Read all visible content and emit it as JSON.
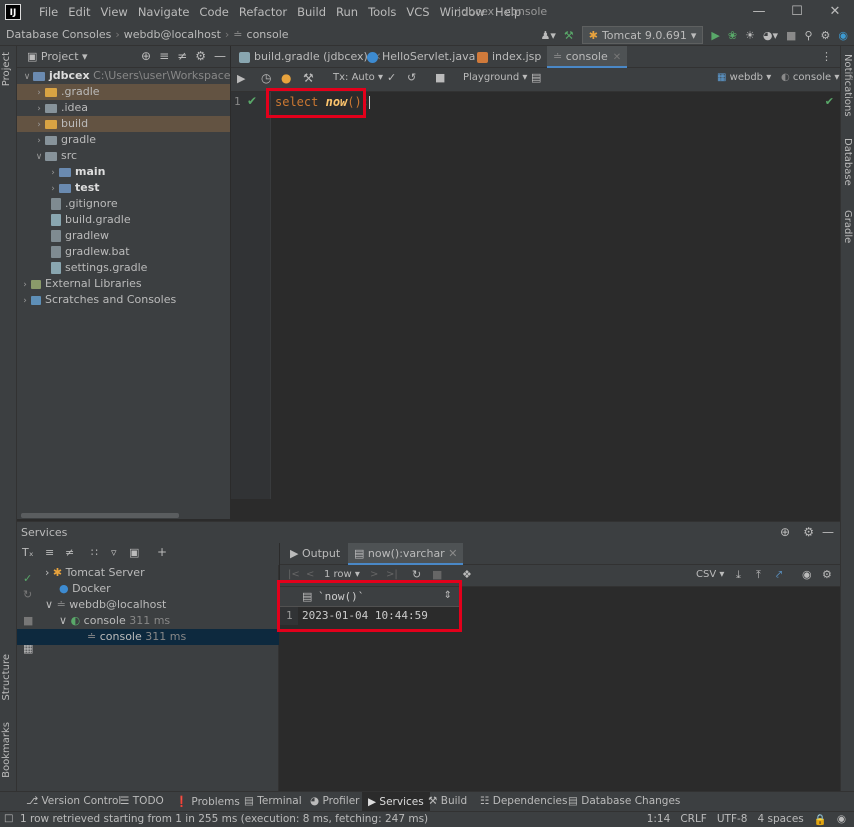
{
  "title_bar": {
    "logo": "IJ",
    "menu": [
      "File",
      "Edit",
      "View",
      "Navigate",
      "Code",
      "Refactor",
      "Build",
      "Run",
      "Tools",
      "VCS",
      "Window",
      "Help"
    ],
    "app_title": "jdbcex - console",
    "controls": [
      "minimize-icon",
      "maximize-icon",
      "close-icon"
    ]
  },
  "nav_bar": {
    "breadcrumbs": [
      "Database Consoles",
      "webdb@localhost",
      "console"
    ],
    "run_config": "Tomcat 9.0.691"
  },
  "left_stripe": {
    "project": "Project",
    "structure": "Structure",
    "bookmarks": "Bookmarks"
  },
  "right_stripe": {
    "notifications": "Notifications",
    "database": "Database",
    "gradle": "Gradle"
  },
  "project_panel": {
    "title": "Project",
    "root": {
      "name": "jdbcex",
      "path": "C:\\Users\\user\\Workspace\\stud"
    },
    "items": [
      {
        "label": ".gradle"
      },
      {
        "label": ".idea"
      },
      {
        "label": "build"
      },
      {
        "label": "gradle"
      },
      {
        "label": "src"
      },
      {
        "label": "main"
      },
      {
        "label": "test"
      },
      {
        "label": ".gitignore"
      },
      {
        "label": "build.gradle"
      },
      {
        "label": "gradlew"
      },
      {
        "label": "gradlew.bat"
      },
      {
        "label": "settings.gradle"
      },
      {
        "label": "External Libraries"
      },
      {
        "label": "Scratches and Consoles"
      }
    ]
  },
  "editor_tabs": [
    "build.gradle (jdbcex)",
    "HelloServlet.java",
    "index.jsp",
    "console"
  ],
  "console_toolbar": {
    "tx": "Tx: Auto",
    "playground": "Playground",
    "datasource": "webdb",
    "session": "console"
  },
  "editor": {
    "line_number": "1",
    "keyword": "select",
    "function": "now",
    "punct": "();"
  },
  "services": {
    "title": "Services",
    "tree": [
      {
        "label": "Tomcat Server"
      },
      {
        "label": "Docker"
      },
      {
        "label": "webdb@localhost"
      },
      {
        "label": "console",
        "time": "311 ms"
      },
      {
        "label": "console",
        "time": "311 ms"
      }
    ],
    "output_tabs": [
      "Output",
      "now():varchar"
    ],
    "grid_toolbar": {
      "rows": "1 row",
      "export": "CSV"
    },
    "result": {
      "column": "`now()`",
      "row_number": "1",
      "value": "2023-01-04 10:44:59"
    }
  },
  "bottom_tools": [
    "Version Control",
    "TODO",
    "Problems",
    "Terminal",
    "Profiler",
    "Services",
    "Build",
    "Dependencies",
    "Database Changes"
  ],
  "status_bar": {
    "message": "1 row retrieved starting from 1 in 255 ms (execution: 8 ms, fetching: 247 ms)",
    "position": "1:14",
    "line_ending": "CRLF",
    "encoding": "UTF-8",
    "indent": "4 spaces"
  }
}
